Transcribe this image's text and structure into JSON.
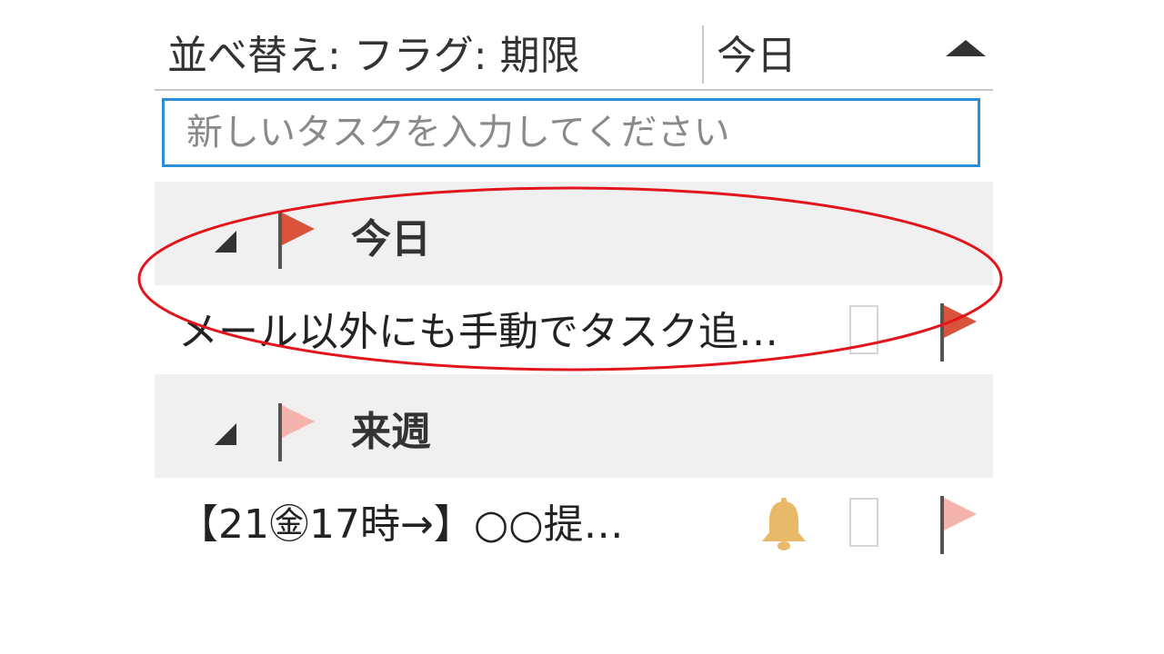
{
  "sort_bar": {
    "label": "並べ替え: フラグ: 期限",
    "value": "今日",
    "toggle_icon": "triangle-up-icon"
  },
  "new_task": {
    "placeholder": "新しいタスクを入力してください",
    "value": ""
  },
  "groups": [
    {
      "title": "今日",
      "flag_color": "#d9533b",
      "tasks": [
        {
          "subject": "メール以外にも手動でタスク追…",
          "has_reminder": false,
          "flag_color": "#d9533b"
        }
      ]
    },
    {
      "title": "来週",
      "flag_color": "#f4b4ad",
      "tasks": [
        {
          "subject": "【21㊎17時→】○○提…",
          "has_reminder": true,
          "reminder_icon": "bell-icon",
          "reminder_color": "#e9b96a",
          "flag_color": "#f4b4ad"
        }
      ]
    }
  ],
  "annotation": {
    "color": "#e2151c"
  }
}
